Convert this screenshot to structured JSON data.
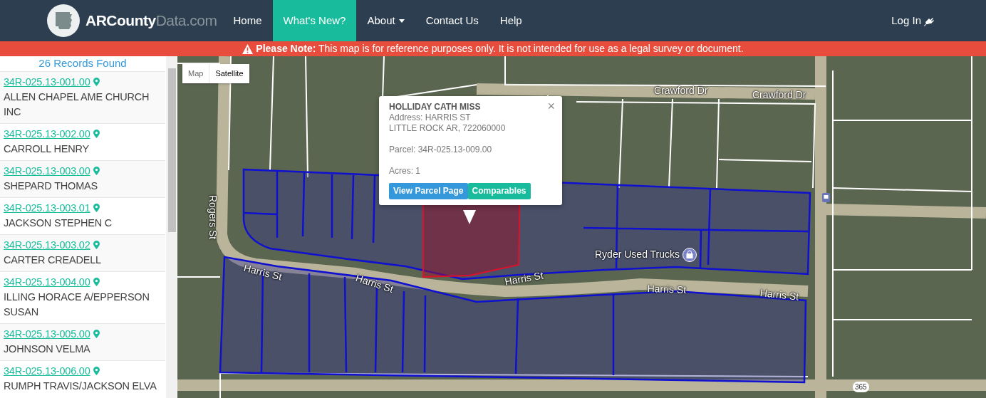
{
  "navbar": {
    "brand": {
      "bold": "ARCounty",
      "light": "Data",
      "suffix": ".com"
    },
    "items": [
      {
        "label": "Home",
        "selected": false,
        "has_caret": false
      },
      {
        "label": "What's New?",
        "selected": true,
        "has_caret": false
      },
      {
        "label": "About",
        "selected": false,
        "has_caret": true
      },
      {
        "label": "Contact Us",
        "selected": false,
        "has_caret": false
      },
      {
        "label": "Help",
        "selected": false,
        "has_caret": false
      }
    ],
    "login": "Log In"
  },
  "notice": {
    "text": "**Please Note:** This map is for reference purposes only. It is not intended for use as a legal survey or document."
  },
  "sidebar": {
    "count": "26 Records Found",
    "records": [
      {
        "parcel": "34R-025.13-001.00",
        "owner": "ALLEN CHAPEL AME CHURCH INC"
      },
      {
        "parcel": "34R-025.13-002.00",
        "owner": "CARROLL HENRY"
      },
      {
        "parcel": "34R-025.13-003.00",
        "owner": "SHEPARD THOMAS"
      },
      {
        "parcel": "34R-025.13-003.01",
        "owner": "JACKSON STEPHEN C"
      },
      {
        "parcel": "34R-025.13-003.02",
        "owner": "CARTER CREADELL"
      },
      {
        "parcel": "34R-025.13-004.00",
        "owner": "ILLING HORACE A/EPPERSON SUSAN"
      },
      {
        "parcel": "34R-025.13-005.00",
        "owner": "JOHNSON VELMA"
      },
      {
        "parcel": "34R-025.13-006.00",
        "owner": "RUMPH TRAVIS/JACKSON ELVA"
      }
    ]
  },
  "map": {
    "type_toggle": [
      {
        "label": "Map",
        "selected": false
      },
      {
        "label": "Satellite",
        "selected": true
      }
    ],
    "labels": [
      {
        "text": "Crawford Dr",
        "kind": "street"
      },
      {
        "text": "Crawford Dr",
        "kind": "street"
      },
      {
        "text": "Rogers St",
        "kind": "street"
      },
      {
        "text": "Ryder Used Trucks",
        "kind": "place"
      },
      {
        "text": "Harris St",
        "kind": "street"
      },
      {
        "text": "Harris St",
        "kind": "street"
      },
      {
        "text": "Harris St",
        "kind": "street"
      },
      {
        "text": "Harris St",
        "kind": "street"
      },
      {
        "text": "Harris St",
        "kind": "street"
      },
      {
        "text": "365",
        "kind": "route"
      }
    ],
    "popup": {
      "title": "HOLLIDAY CATH MISS",
      "groups": [
        [
          "Address: HARRIS ST",
          "LITTLE ROCK AR, 722060000"
        ],
        [
          "Parcel: 34R-025.13-009.00"
        ],
        [
          "Acres: 1"
        ]
      ],
      "close": "×",
      "buttons": [
        {
          "label": "View Parcel Page",
          "kind": "primary"
        },
        {
          "label": "Comparables",
          "kind": "success"
        }
      ]
    }
  }
}
